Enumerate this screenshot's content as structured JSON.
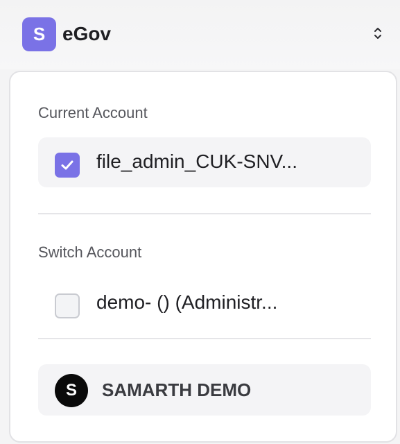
{
  "header": {
    "logo_letter": "S",
    "app_name": "eGov",
    "toggle_icon": "chevron-up-down-icon"
  },
  "current_section": {
    "label": "Current Account",
    "account": {
      "name": "file_admin_CUK-SNV...",
      "checked": true
    }
  },
  "switch_section": {
    "label": "Switch Account",
    "accounts": [
      {
        "name": "demo- () (Administr...",
        "checked": false
      }
    ]
  },
  "organization": {
    "avatar_letter": "S",
    "name": "SAMARTH DEMO"
  },
  "colors": {
    "accent": "#7a72e6",
    "avatar_bg": "#0a0a0a",
    "row_bg": "#f4f4f6",
    "border": "#e2e2e5"
  }
}
